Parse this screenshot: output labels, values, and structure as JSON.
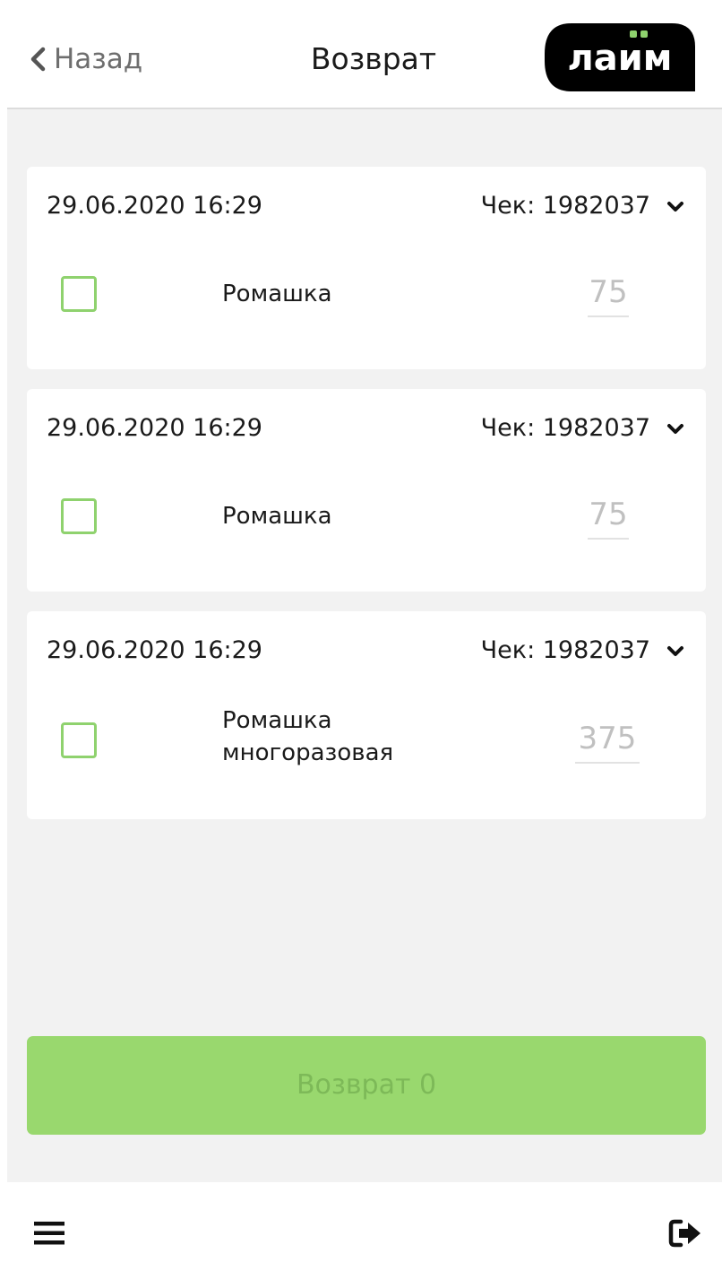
{
  "header": {
    "back_label": "Назад",
    "title": "Возврат",
    "logo_text": "лаим",
    "brand_color": "#8fd26e"
  },
  "receipts": [
    {
      "datetime": "29.06.2020 16:29",
      "check": "Чек: 1982037",
      "product_line1": "Ромашка",
      "product_line2": "",
      "amount": "75"
    },
    {
      "datetime": "29.06.2020 16:29",
      "check": "Чек: 1982037",
      "product_line1": "Ромашка",
      "product_line2": "",
      "amount": "75"
    },
    {
      "datetime": "29.06.2020 16:29",
      "check": "Чек: 1982037",
      "product_line1": "Ромашка",
      "product_line2": "многоразовая",
      "amount": "375"
    }
  ],
  "return_button": {
    "label": "Возврат 0",
    "color": "#99d86e"
  },
  "bottombar": {
    "menu_icon": "hamburger-menu-icon",
    "logout_icon": "logout-icon"
  }
}
